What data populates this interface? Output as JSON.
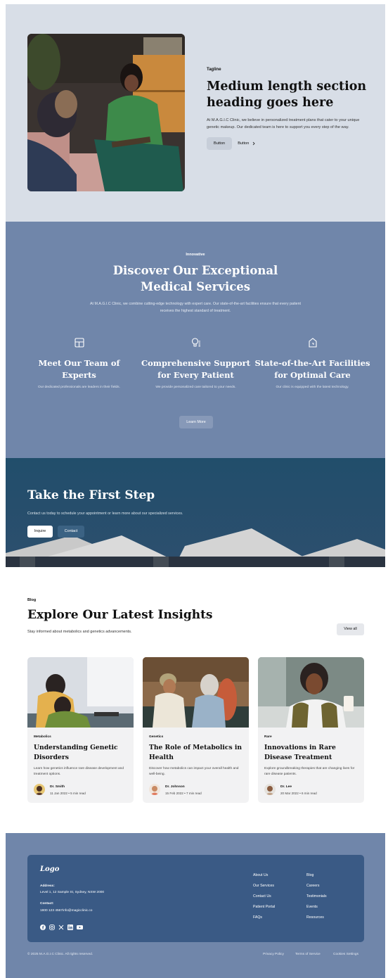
{
  "hero": {
    "tagline": "Tagline",
    "heading": "Medium length section heading goes here",
    "body": "At M.A.G.I.C Clinic, we believe in personalized treatment plans that cater to your unique genetic makeup. Our dedicated team is here to support you every step of the way.",
    "button_primary": "Button",
    "button_secondary": "Button"
  },
  "services": {
    "tagline": "Innovative",
    "heading": "Discover Our Exceptional Medical Services",
    "body": "At M.A.G.I.C Clinic, we combine cutting-edge technology with expert care. Our state-of-the-art facilities ensure that every patient receives the highest standard of treatment.",
    "features": [
      {
        "icon": "layout-icon",
        "title": "Meet Our Team of Experts",
        "text": "Our dedicated professionals are leaders in their fields."
      },
      {
        "icon": "lightbulb-icon",
        "title": "Comprehensive Support for Every Patient",
        "text": "We provide personalized care tailored to your needs."
      },
      {
        "icon": "building-icon",
        "title": "State-of-the-Art Facilities for Optimal Care",
        "text": "Our clinic is equipped with the latest technology."
      }
    ],
    "button": "Learn More"
  },
  "cta": {
    "heading": "Take the First Step",
    "body": "Contact us today to schedule your appointment or learn more about our specialized services.",
    "button_primary": "Inquire",
    "button_secondary": "Contact"
  },
  "blog": {
    "tagline": "Blog",
    "heading": "Explore Our Latest Insights",
    "subtitle": "Stay informed about metabolics and genetics advancements.",
    "view_all": "View all",
    "posts": [
      {
        "category": "Metabolics",
        "title": "Understanding Genetic Disorders",
        "excerpt": "Learn how genetics influence rare disease development and treatment options.",
        "author": "Dr. Smith",
        "date": "11 Jan 2022",
        "read": "5 min read"
      },
      {
        "category": "Genetics",
        "title": "The Role of Metabolics in Health",
        "excerpt": "Discover how metabolics can impact your overall health and well-being.",
        "author": "Dr. Johnson",
        "date": "15 Feb 2022",
        "read": "7 min read"
      },
      {
        "category": "Rare",
        "title": "Innovations in Rare Disease Treatment",
        "excerpt": "Explore groundbreaking therapies that are changing lives for rare disease patients.",
        "author": "Dr. Lee",
        "date": "20 Mar 2022",
        "read": "6 min read"
      }
    ]
  },
  "footer": {
    "logo": "Logo",
    "address_label": "Address:",
    "address": "Level 1, 12 Sample St, Sydney, NSW 2000",
    "contact_label": "Contact:",
    "contact": "1800 123 4567info@magicclinic.co",
    "col1": [
      "About Us",
      "Our Services",
      "Contact Us",
      "Patient Portal",
      "FAQs"
    ],
    "col2": [
      "Blog",
      "Careers",
      "Testimonials",
      "Events",
      "Resources"
    ],
    "copyright": "© 2025 M.A.G.I.C Clinic. All rights reserved.",
    "legal": [
      "Privacy Policy",
      "Terms of Service",
      "Cookies Settings"
    ],
    "social_icons": [
      "facebook-icon",
      "instagram-icon",
      "x-icon",
      "linkedin-icon",
      "youtube-icon"
    ]
  },
  "colors": {
    "hero_bg": "#d8dee7",
    "services_bg": "#7086aa",
    "cta_bg": "#24506e",
    "footer_box": "#3a5a85"
  }
}
